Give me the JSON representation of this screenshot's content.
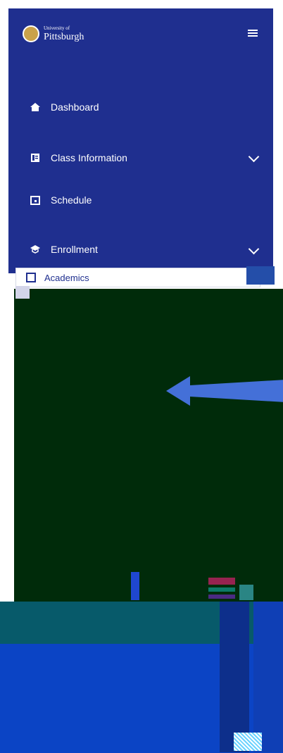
{
  "brand": {
    "small": "University of",
    "name": "Pittsburgh"
  },
  "nav": {
    "items": [
      {
        "label": "Dashboard",
        "icon": "home-icon"
      },
      {
        "label": "Class Information",
        "icon": "book-icon"
      },
      {
        "label": "Schedule",
        "icon": "calendar-icon"
      },
      {
        "label": "Enrollment",
        "icon": "graduation-cap-icon"
      }
    ],
    "academics": "Academics"
  },
  "colors": {
    "sidebar": "#1f2f8f",
    "dark_area": "#002b0a",
    "arrow": "#4470d8"
  }
}
